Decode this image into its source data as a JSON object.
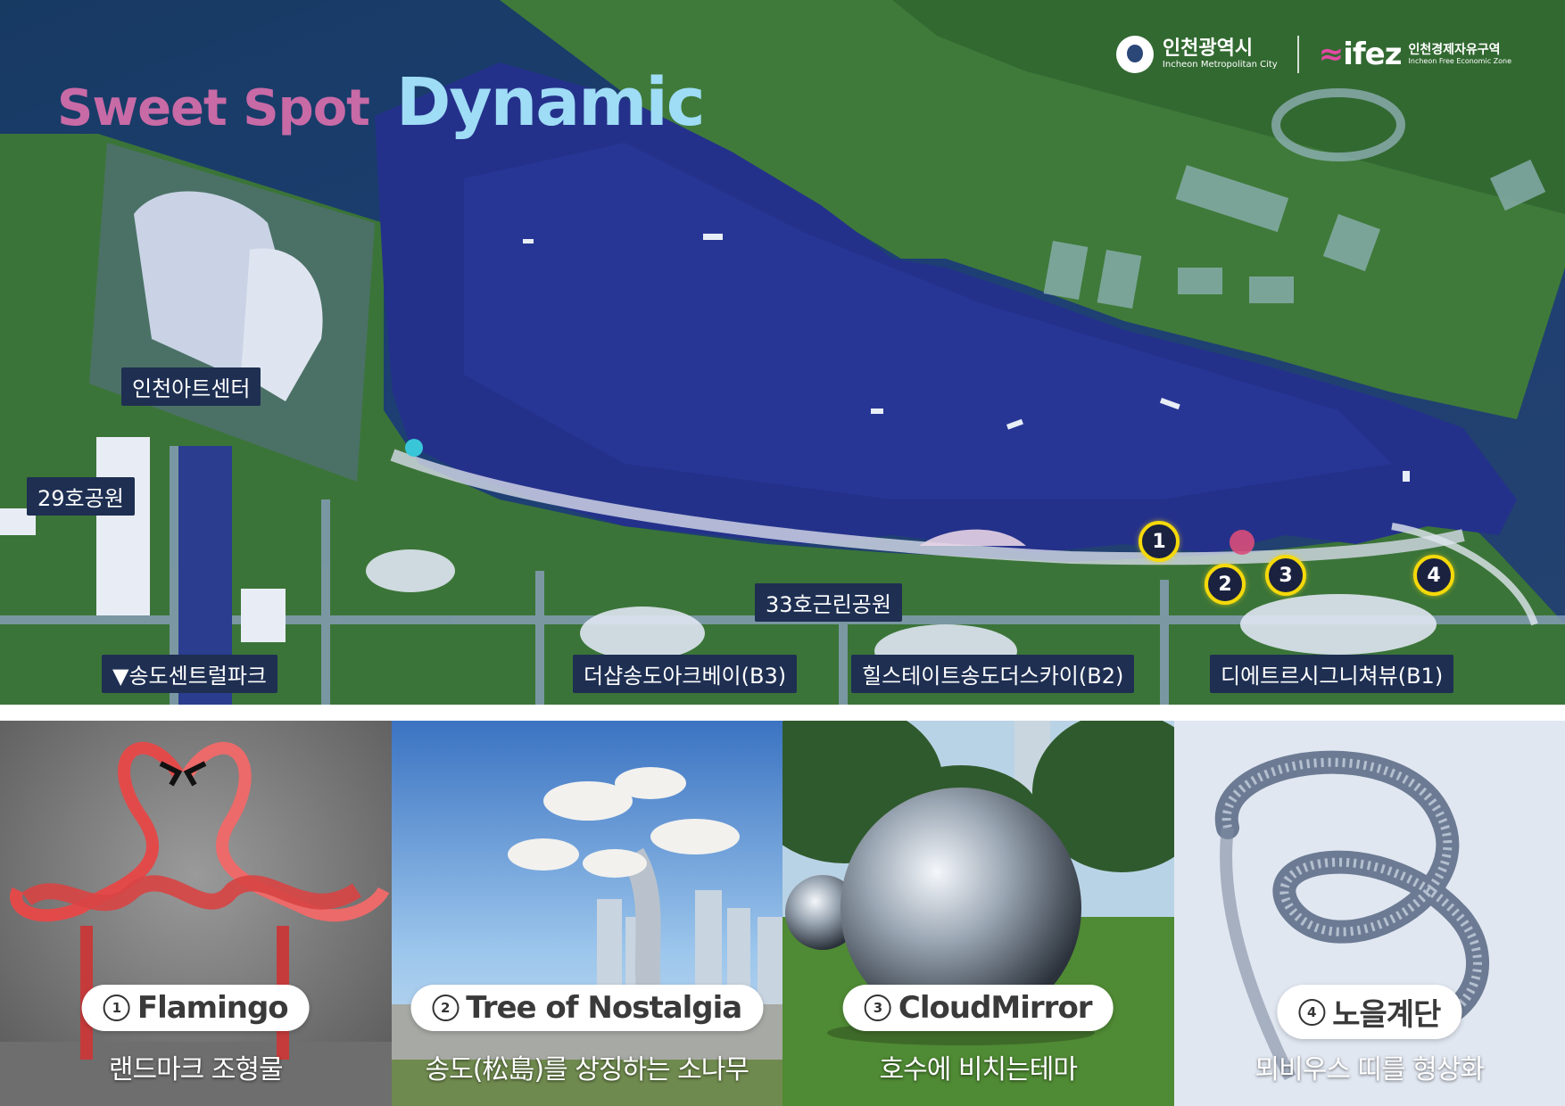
{
  "title": {
    "sweet": "Sweet Spot",
    "dynamic": "Dynamic"
  },
  "logos": {
    "incheon_ko": "인천광역시",
    "incheon_en": "Incheon Metropolitan City",
    "ifez_mark_a": "≈",
    "ifez_mark_b": "ifez",
    "ifez_ko": "인천경제자유구역",
    "ifez_en": "Incheon Free Economic Zone"
  },
  "places": {
    "art_center": "인천아트센터",
    "park29": "29호공원",
    "central_park": "▼송도센트럴파크",
    "park33": "33호근린공원",
    "b3": "더샵송도아크베이(B3)",
    "b2": "힐스테이트송도더스카이(B2)",
    "b1": "디에트르시그니쳐뷰(B1)"
  },
  "markers": [
    "1",
    "2",
    "3",
    "4"
  ],
  "panels": [
    {
      "num": "1",
      "name": "Flamingo",
      "caption": "랜드마크 조형물"
    },
    {
      "num": "2",
      "name": "Tree of Nostalgia",
      "caption": "송도(松島)를 상징하는 소나무"
    },
    {
      "num": "3",
      "name": "CloudMirror",
      "caption": "호수에 비치는테마"
    },
    {
      "num": "4",
      "name": "노을계단",
      "caption": "뫼비우스 띠를 형상화"
    }
  ]
}
